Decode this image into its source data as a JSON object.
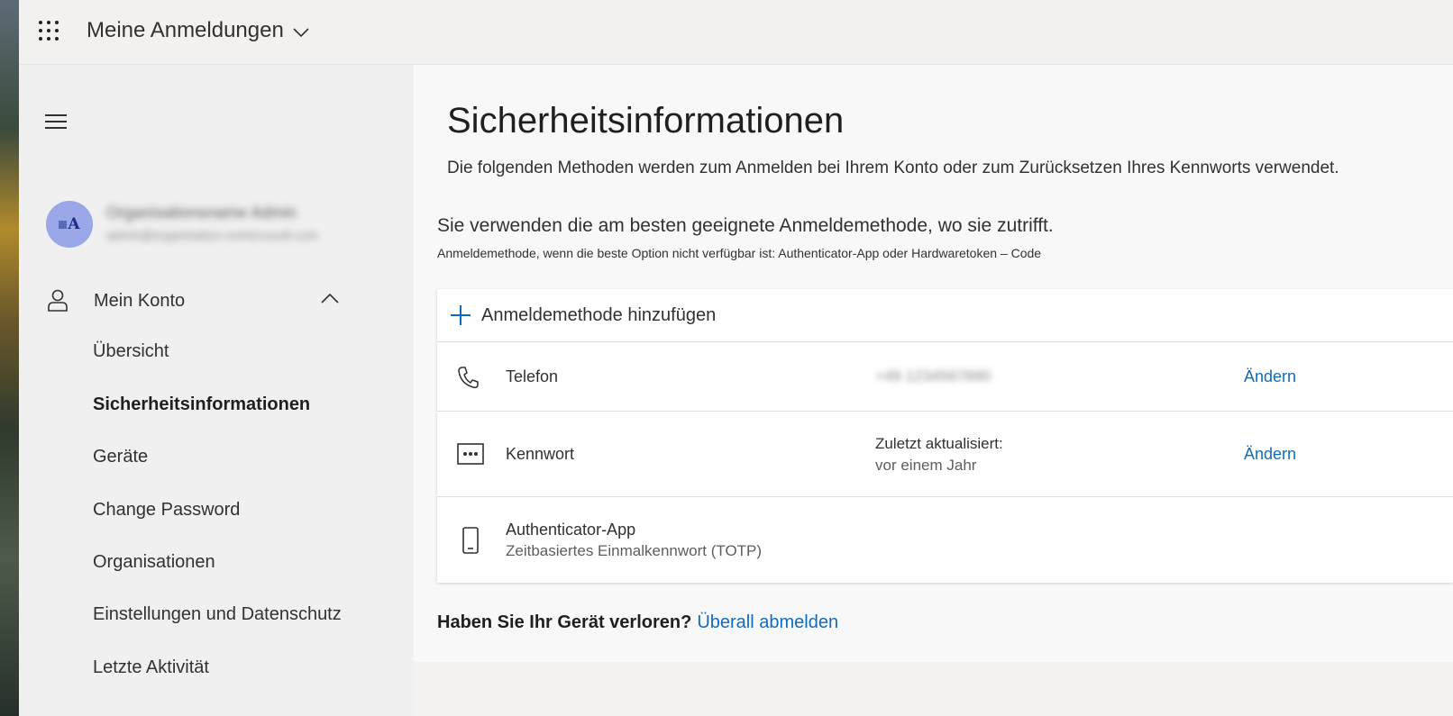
{
  "header": {
    "app_title": "Meine Anmeldungen",
    "waffle_icon": "app-launcher-icon",
    "title_chevron_icon": "chevron-down-icon"
  },
  "sidebar": {
    "menu_icon": "hamburger-icon",
    "user": {
      "avatar_initials": "A",
      "name": "Organisationsname Admin",
      "email": "admin@organisation.onmicrosoft.com"
    },
    "section": {
      "icon": "person-icon",
      "label": "Mein Konto",
      "expanded_icon": "chevron-up-icon"
    },
    "items": [
      {
        "label": "Übersicht",
        "active": false
      },
      {
        "label": "Sicherheitsinformationen",
        "active": true
      },
      {
        "label": "Geräte",
        "active": false
      },
      {
        "label": "Change Password",
        "active": false
      },
      {
        "label": "Organisationen",
        "active": false
      },
      {
        "label": "Einstellungen und Datenschutz",
        "active": false
      },
      {
        "label": "Letzte Aktivität",
        "active": false
      }
    ]
  },
  "main": {
    "title": "Sicherheitsinformationen",
    "description": "Die folgenden Methoden werden zum Anmelden bei Ihrem Konto oder zum Zurücksetzen Ihres Kennworts verwendet.",
    "default_method_title": "Sie verwenden die am besten geeignete Anmeldemethode, wo sie zutrifft.",
    "default_method_subtitle": "Anmeldemethode, wenn die beste Option nicht verfügbar ist: Authenticator-App oder Hardwaretoken – Code",
    "add_method_label": "Anmeldemethode hinzufügen",
    "methods": [
      {
        "icon": "phone-icon",
        "name": "Telefon",
        "detail": "+49 1234567890",
        "action": "Ändern"
      },
      {
        "icon": "password-icon",
        "name": "Kennwort",
        "detail": "Zuletzt aktualisiert:",
        "detail_sub": "vor einem Jahr",
        "action": "Ändern"
      },
      {
        "icon": "mobile-device-icon",
        "name": "Authenticator-App",
        "name_sub": "Zeitbasiertes Einmalkennwort (TOTP)"
      }
    ],
    "lost_device_question": "Haben Sie Ihr Gerät verloren?",
    "lost_device_link": "Überall abmelden"
  },
  "colors": {
    "link": "#0f6cbd",
    "avatar_bg": "#9aa7e8",
    "sidebar_bg": "#f0f0f0",
    "main_bg": "#f8f8f8"
  }
}
